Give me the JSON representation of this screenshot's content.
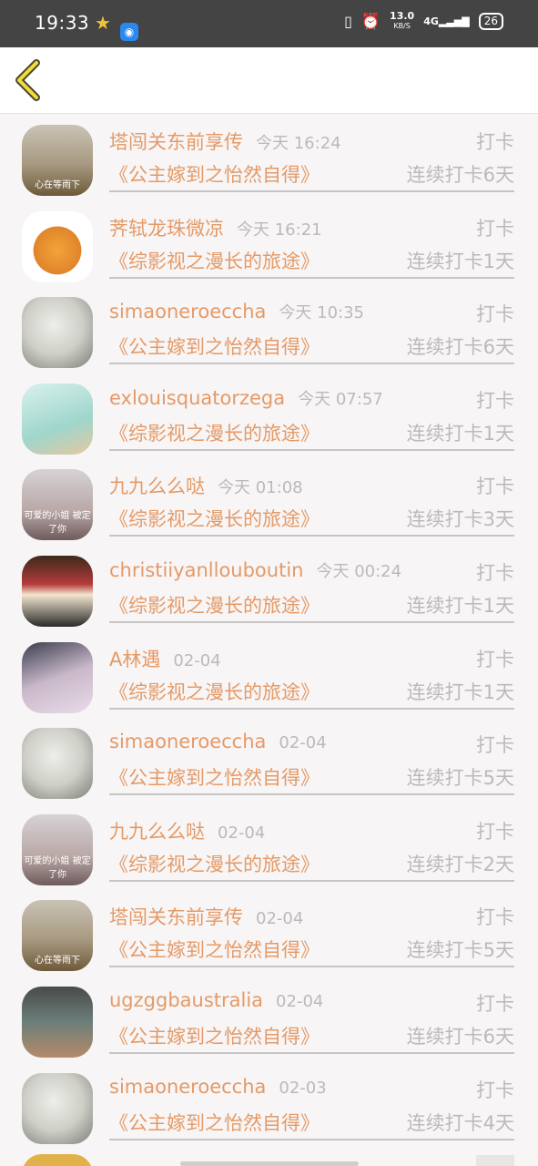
{
  "status_bar": {
    "time": "19:33",
    "speed_value": "13.0",
    "speed_unit": "KB/S",
    "network": "4G",
    "battery": "26"
  },
  "nav": {
    "back_icon": "chevron-left-icon"
  },
  "rows": [
    {
      "name": "塔闯关东前享传",
      "time": "今天 16:24",
      "tag": "打卡",
      "book": "《公主嫁到之怡然自得》",
      "streak": "连续打卡6天",
      "avatar_caption": "心在等雨下"
    },
    {
      "name": "荠轼龙珠微凉",
      "time": "今天 16:21",
      "tag": "打卡",
      "book": "《综影视之漫长的旅途》",
      "streak": "连续打卡1天",
      "avatar_caption": ""
    },
    {
      "name": "simaoneroeccha",
      "time": "今天 10:35",
      "tag": "打卡",
      "book": "《公主嫁到之怡然自得》",
      "streak": "连续打卡6天",
      "avatar_caption": ""
    },
    {
      "name": "exlouisquatorzega",
      "time": "今天 07:57",
      "tag": "打卡",
      "book": "《综影视之漫长的旅途》",
      "streak": "连续打卡1天",
      "avatar_caption": ""
    },
    {
      "name": "九九么么哒",
      "time": "今天 01:08",
      "tag": "打卡",
      "book": "《综影视之漫长的旅途》",
      "streak": "连续打卡3天",
      "avatar_caption": "可爱的小姐 被定了你"
    },
    {
      "name": "christiiyanllouboutin",
      "time": "今天 00:24",
      "tag": "打卡",
      "book": "《综影视之漫长的旅途》",
      "streak": "连续打卡1天",
      "avatar_caption": ""
    },
    {
      "name": "A林遇",
      "time": "02-04",
      "tag": "打卡",
      "book": "《综影视之漫长的旅途》",
      "streak": "连续打卡1天",
      "avatar_caption": ""
    },
    {
      "name": "simaoneroeccha",
      "time": "02-04",
      "tag": "打卡",
      "book": "《公主嫁到之怡然自得》",
      "streak": "连续打卡5天",
      "avatar_caption": ""
    },
    {
      "name": "九九么么哒",
      "time": "02-04",
      "tag": "打卡",
      "book": "《综影视之漫长的旅途》",
      "streak": "连续打卡2天",
      "avatar_caption": "可爱的小姐 被定了你"
    },
    {
      "name": "塔闯关东前享传",
      "time": "02-04",
      "tag": "打卡",
      "book": "《公主嫁到之怡然自得》",
      "streak": "连续打卡5天",
      "avatar_caption": "心在等雨下"
    },
    {
      "name": "ugzggbaustralia",
      "time": "02-04",
      "tag": "打卡",
      "book": "《公主嫁到之怡然自得》",
      "streak": "连续打卡6天",
      "avatar_caption": ""
    },
    {
      "name": "simaoneroeccha",
      "time": "02-03",
      "tag": "打卡",
      "book": "《公主嫁到之怡然自得》",
      "streak": "连续打卡4天",
      "avatar_caption": ""
    }
  ]
}
